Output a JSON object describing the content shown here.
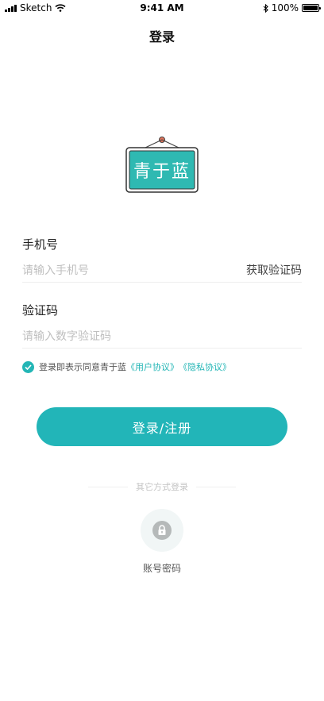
{
  "status_bar": {
    "carrier": "Sketch",
    "time": "9:41 AM",
    "battery": "100%",
    "battery_level": 1.0
  },
  "header": {
    "title": "登录"
  },
  "logo": {
    "text": "青于蓝",
    "icon": "shop-sign-logo"
  },
  "phone": {
    "label": "手机号",
    "placeholder": "请输入手机号",
    "get_code": "获取验证码"
  },
  "code": {
    "label": "验证码",
    "placeholder": "请输入数字验证码"
  },
  "agreement": {
    "checked": true,
    "text": "登录即表示同意青于蓝",
    "user_agreement": "《用户协议》",
    "privacy_policy": "《隐私协议》"
  },
  "primary_button": {
    "label": "登录/注册"
  },
  "other_login": {
    "title": "其它方式登录",
    "account_label": "账号密码",
    "account_icon": "lock-icon"
  },
  "colors": {
    "accent": "#22b5b8",
    "logo_board": "#2fb9b2"
  }
}
